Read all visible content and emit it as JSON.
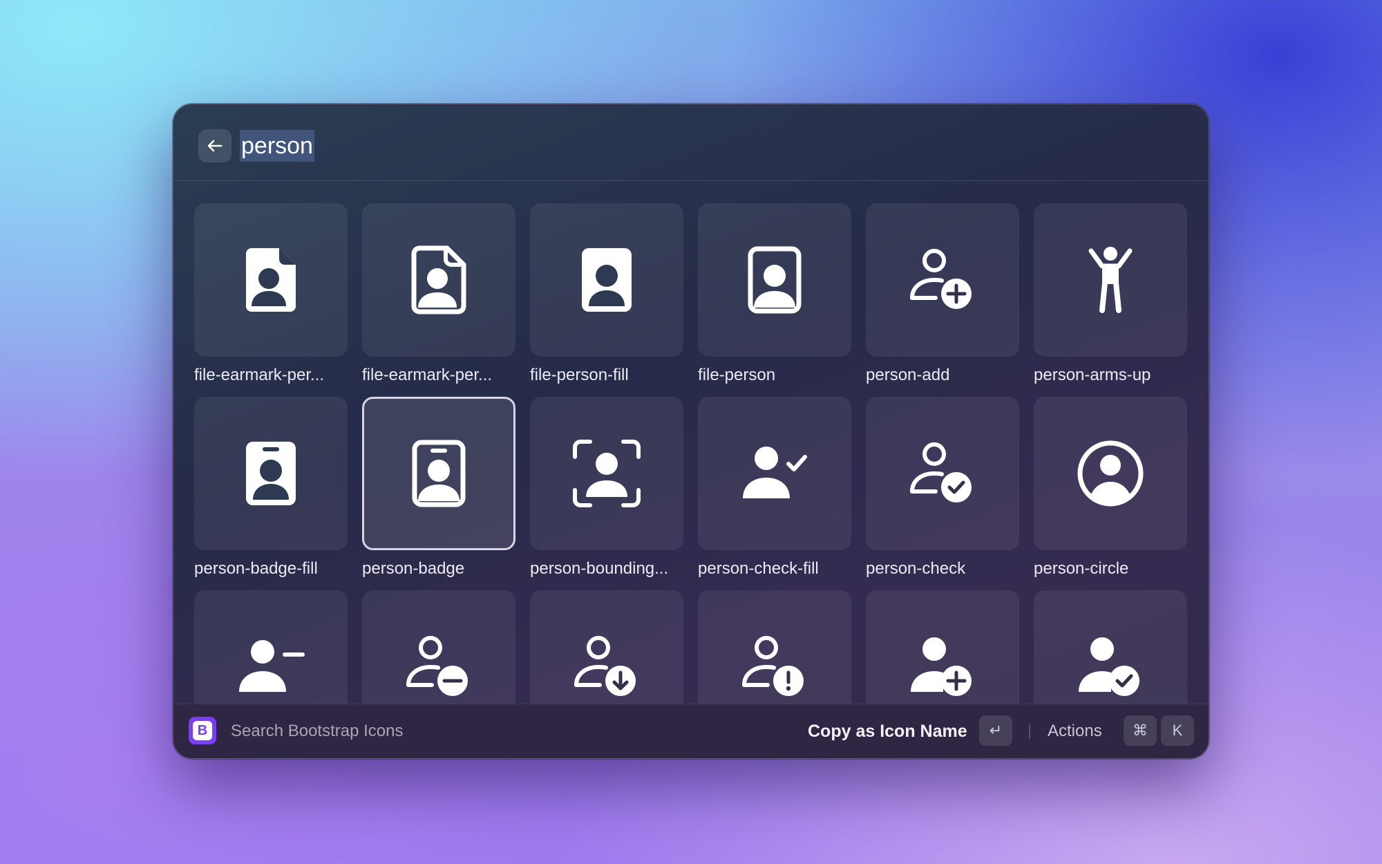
{
  "search": {
    "query": "person"
  },
  "footer": {
    "extension_name": "Search Bootstrap Icons",
    "logo_letter": "B",
    "primary_action": "Copy as Icon Name",
    "enter_key": "↵",
    "actions_label": "Actions",
    "cmd_key": "⌘",
    "k_key": "K"
  },
  "colors": {
    "accent": "#7a3ff2",
    "selection": "#41557a"
  },
  "icons": [
    {
      "label": "file-earmark-per...",
      "icon": "file-earmark-person-fill-icon"
    },
    {
      "label": "file-earmark-per...",
      "icon": "file-earmark-person-icon"
    },
    {
      "label": "file-person-fill",
      "icon": "file-person-fill-icon"
    },
    {
      "label": "file-person",
      "icon": "file-person-icon"
    },
    {
      "label": "person-add",
      "icon": "person-add-icon"
    },
    {
      "label": "person-arms-up",
      "icon": "person-arms-up-icon"
    },
    {
      "label": "person-badge-fill",
      "icon": "person-badge-fill-icon"
    },
    {
      "label": "person-badge",
      "icon": "person-badge-icon",
      "selected": true
    },
    {
      "label": "person-bounding...",
      "icon": "person-bounding-box-icon"
    },
    {
      "label": "person-check-fill",
      "icon": "person-check-fill-icon"
    },
    {
      "label": "person-check",
      "icon": "person-check-icon"
    },
    {
      "label": "person-circle",
      "icon": "person-circle-icon"
    },
    {
      "label": "",
      "icon": "person-dash-fill-icon"
    },
    {
      "label": "",
      "icon": "person-dash-icon"
    },
    {
      "label": "",
      "icon": "person-down-icon"
    },
    {
      "label": "",
      "icon": "person-exclamation-icon"
    },
    {
      "label": "",
      "icon": "person-fill-add-icon"
    },
    {
      "label": "",
      "icon": "person-fill-check-icon"
    }
  ]
}
